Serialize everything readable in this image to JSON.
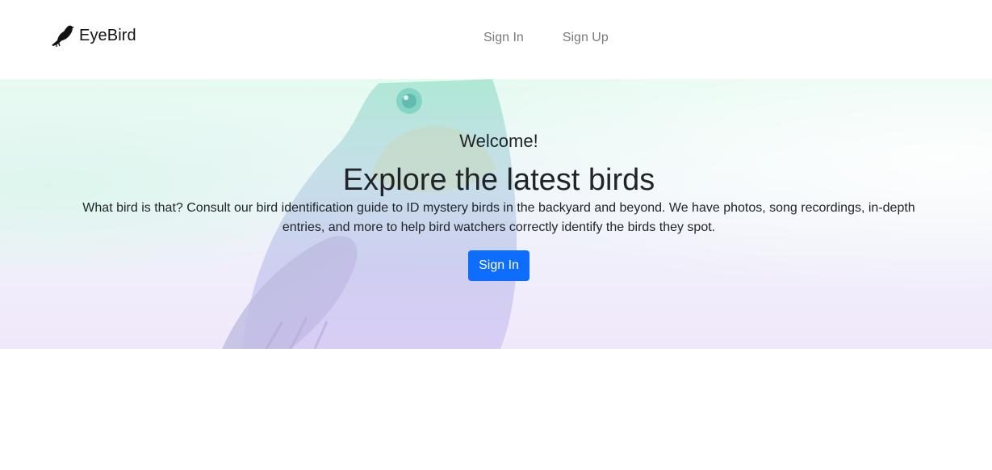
{
  "brand": {
    "name": "EyeBird",
    "icon": "bird-silhouette-icon"
  },
  "nav": {
    "items": [
      {
        "label": "Sign In"
      },
      {
        "label": "Sign Up"
      }
    ]
  },
  "hero": {
    "welcome": "Welcome!",
    "headline": "Explore the latest birds",
    "description": "What bird is that? Consult our bird identification guide to ID mystery birds in the backyard and beyond. We have photos, song recordings, in-depth entries, and more to help bird watchers correctly identify the birds they spot.",
    "cta_label": "Sign In",
    "background_image": "bird-photo"
  },
  "colors": {
    "primary": "#0d6efd",
    "nav_link": "#7a7a7a",
    "text": "#212529"
  }
}
